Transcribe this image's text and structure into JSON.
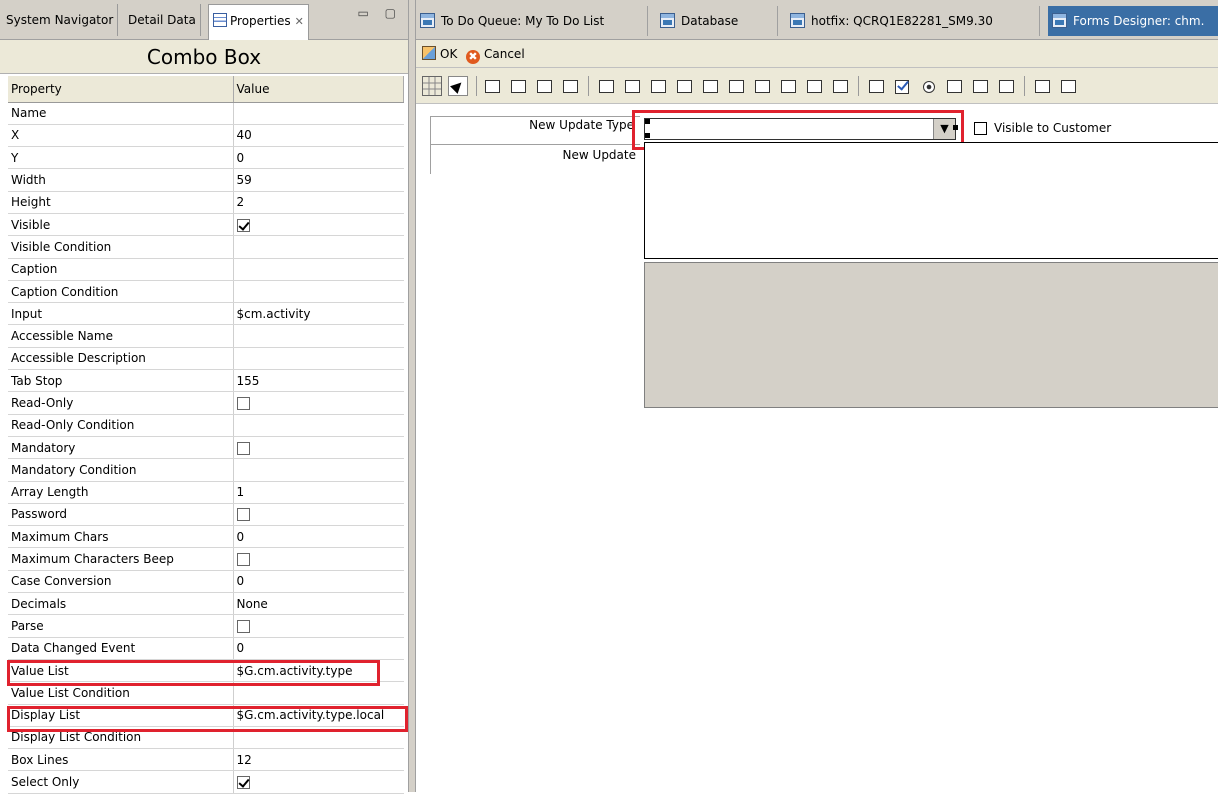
{
  "left_tabs": {
    "system_navigator": "System Navigator",
    "detail_data": "Detail Data",
    "properties": "Properties",
    "properties_close": "✕",
    "window_controls": "▭ ▢"
  },
  "panel_title": "Combo Box",
  "table": {
    "header_property": "Property",
    "header_value": "Value",
    "rows": [
      {
        "name": "Name",
        "value": ""
      },
      {
        "name": "X",
        "value": "40"
      },
      {
        "name": "Y",
        "value": "0"
      },
      {
        "name": "Width",
        "value": "59"
      },
      {
        "name": "Height",
        "value": "2"
      },
      {
        "name": "Visible",
        "checkbox": "checked"
      },
      {
        "name": "Visible Condition",
        "value": ""
      },
      {
        "name": "Caption",
        "value": ""
      },
      {
        "name": "Caption Condition",
        "value": ""
      },
      {
        "name": "Input",
        "value": "$cm.activity"
      },
      {
        "name": "Accessible Name",
        "value": ""
      },
      {
        "name": "Accessible Description",
        "value": ""
      },
      {
        "name": "Tab Stop",
        "value": "155"
      },
      {
        "name": "Read-Only",
        "checkbox": "unchecked"
      },
      {
        "name": "Read-Only Condition",
        "value": ""
      },
      {
        "name": "Mandatory",
        "checkbox": "unchecked"
      },
      {
        "name": "Mandatory Condition",
        "value": ""
      },
      {
        "name": "Array Length",
        "value": "1"
      },
      {
        "name": "Password",
        "checkbox": "unchecked"
      },
      {
        "name": "Maximum Chars",
        "value": "0"
      },
      {
        "name": "Maximum Characters Beep",
        "checkbox": "unchecked"
      },
      {
        "name": "Case Conversion",
        "value": "0"
      },
      {
        "name": "Decimals",
        "value": "None"
      },
      {
        "name": "Parse",
        "checkbox": "unchecked"
      },
      {
        "name": "Data Changed Event",
        "value": "0"
      },
      {
        "name": "Value List",
        "value": "$G.cm.activity.type"
      },
      {
        "name": "Value List Condition",
        "value": ""
      },
      {
        "name": "Display List",
        "value": "$G.cm.activity.type.local"
      },
      {
        "name": "Display List Condition",
        "value": ""
      },
      {
        "name": "Box Lines",
        "value": "12"
      },
      {
        "name": "Select Only",
        "checkbox": "checked"
      }
    ]
  },
  "right_tabs": [
    {
      "label": "To Do Queue: My To Do List",
      "active": false
    },
    {
      "label": "Database",
      "active": false
    },
    {
      "label": "hotfix:  QCRQ1E82281_SM9.30",
      "active": false
    },
    {
      "label": "Forms Designer: chm.",
      "active": true
    }
  ],
  "action_bar": {
    "ok": "OK",
    "cancel": "Cancel"
  },
  "form": {
    "new_update_type_label": "New Update Type",
    "new_update_label": "New Update",
    "visible_to_customer_label": "Visible to Customer",
    "combo_value": ""
  },
  "colors": {
    "highlight": "#e0222e",
    "active_tab": "#3a6ea5",
    "panel_gray": "#d4d0c8"
  }
}
